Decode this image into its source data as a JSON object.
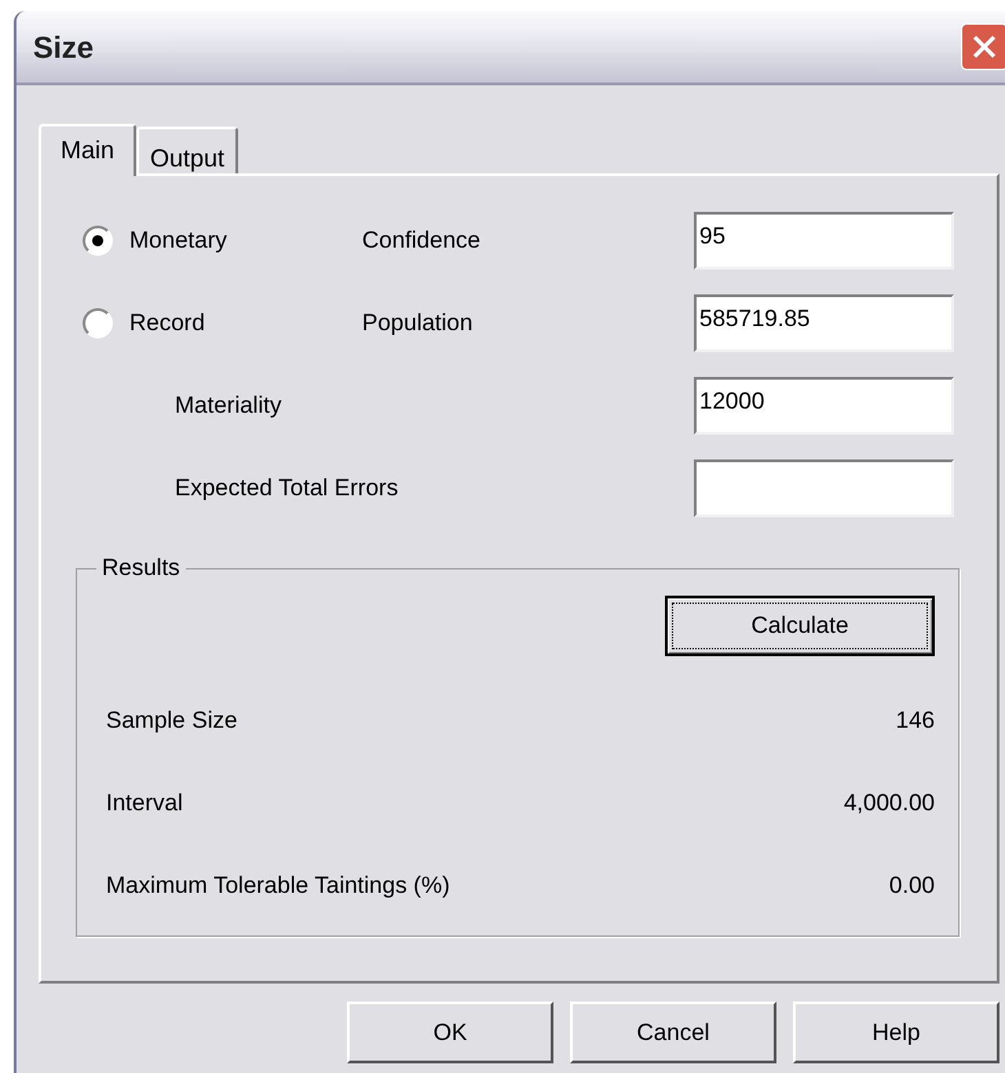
{
  "window": {
    "title": "Size"
  },
  "tabs": [
    {
      "label": "Main",
      "selected": true
    },
    {
      "label": "Output",
      "selected": false
    }
  ],
  "rows": [
    {
      "option": {
        "label": "Monetary",
        "selected": true
      },
      "label": "Confidence",
      "value": "95"
    },
    {
      "option": {
        "label": "Record",
        "selected": false
      },
      "label": "Population",
      "value": "585719.85"
    },
    {
      "label": "Materiality",
      "value": "12000"
    },
    {
      "label": "Expected Total Errors"
    }
  ],
  "results": {
    "title": "Results",
    "button": "Calculate",
    "items": [
      {
        "label": "Sample Size",
        "value": "146"
      },
      {
        "label": "Interval",
        "value": "4,000.00"
      },
      {
        "label": "Maximum Tolerable Taintings (%)",
        "value": "0.00"
      }
    ]
  },
  "buttons": [
    "OK",
    "Cancel",
    "Help"
  ]
}
